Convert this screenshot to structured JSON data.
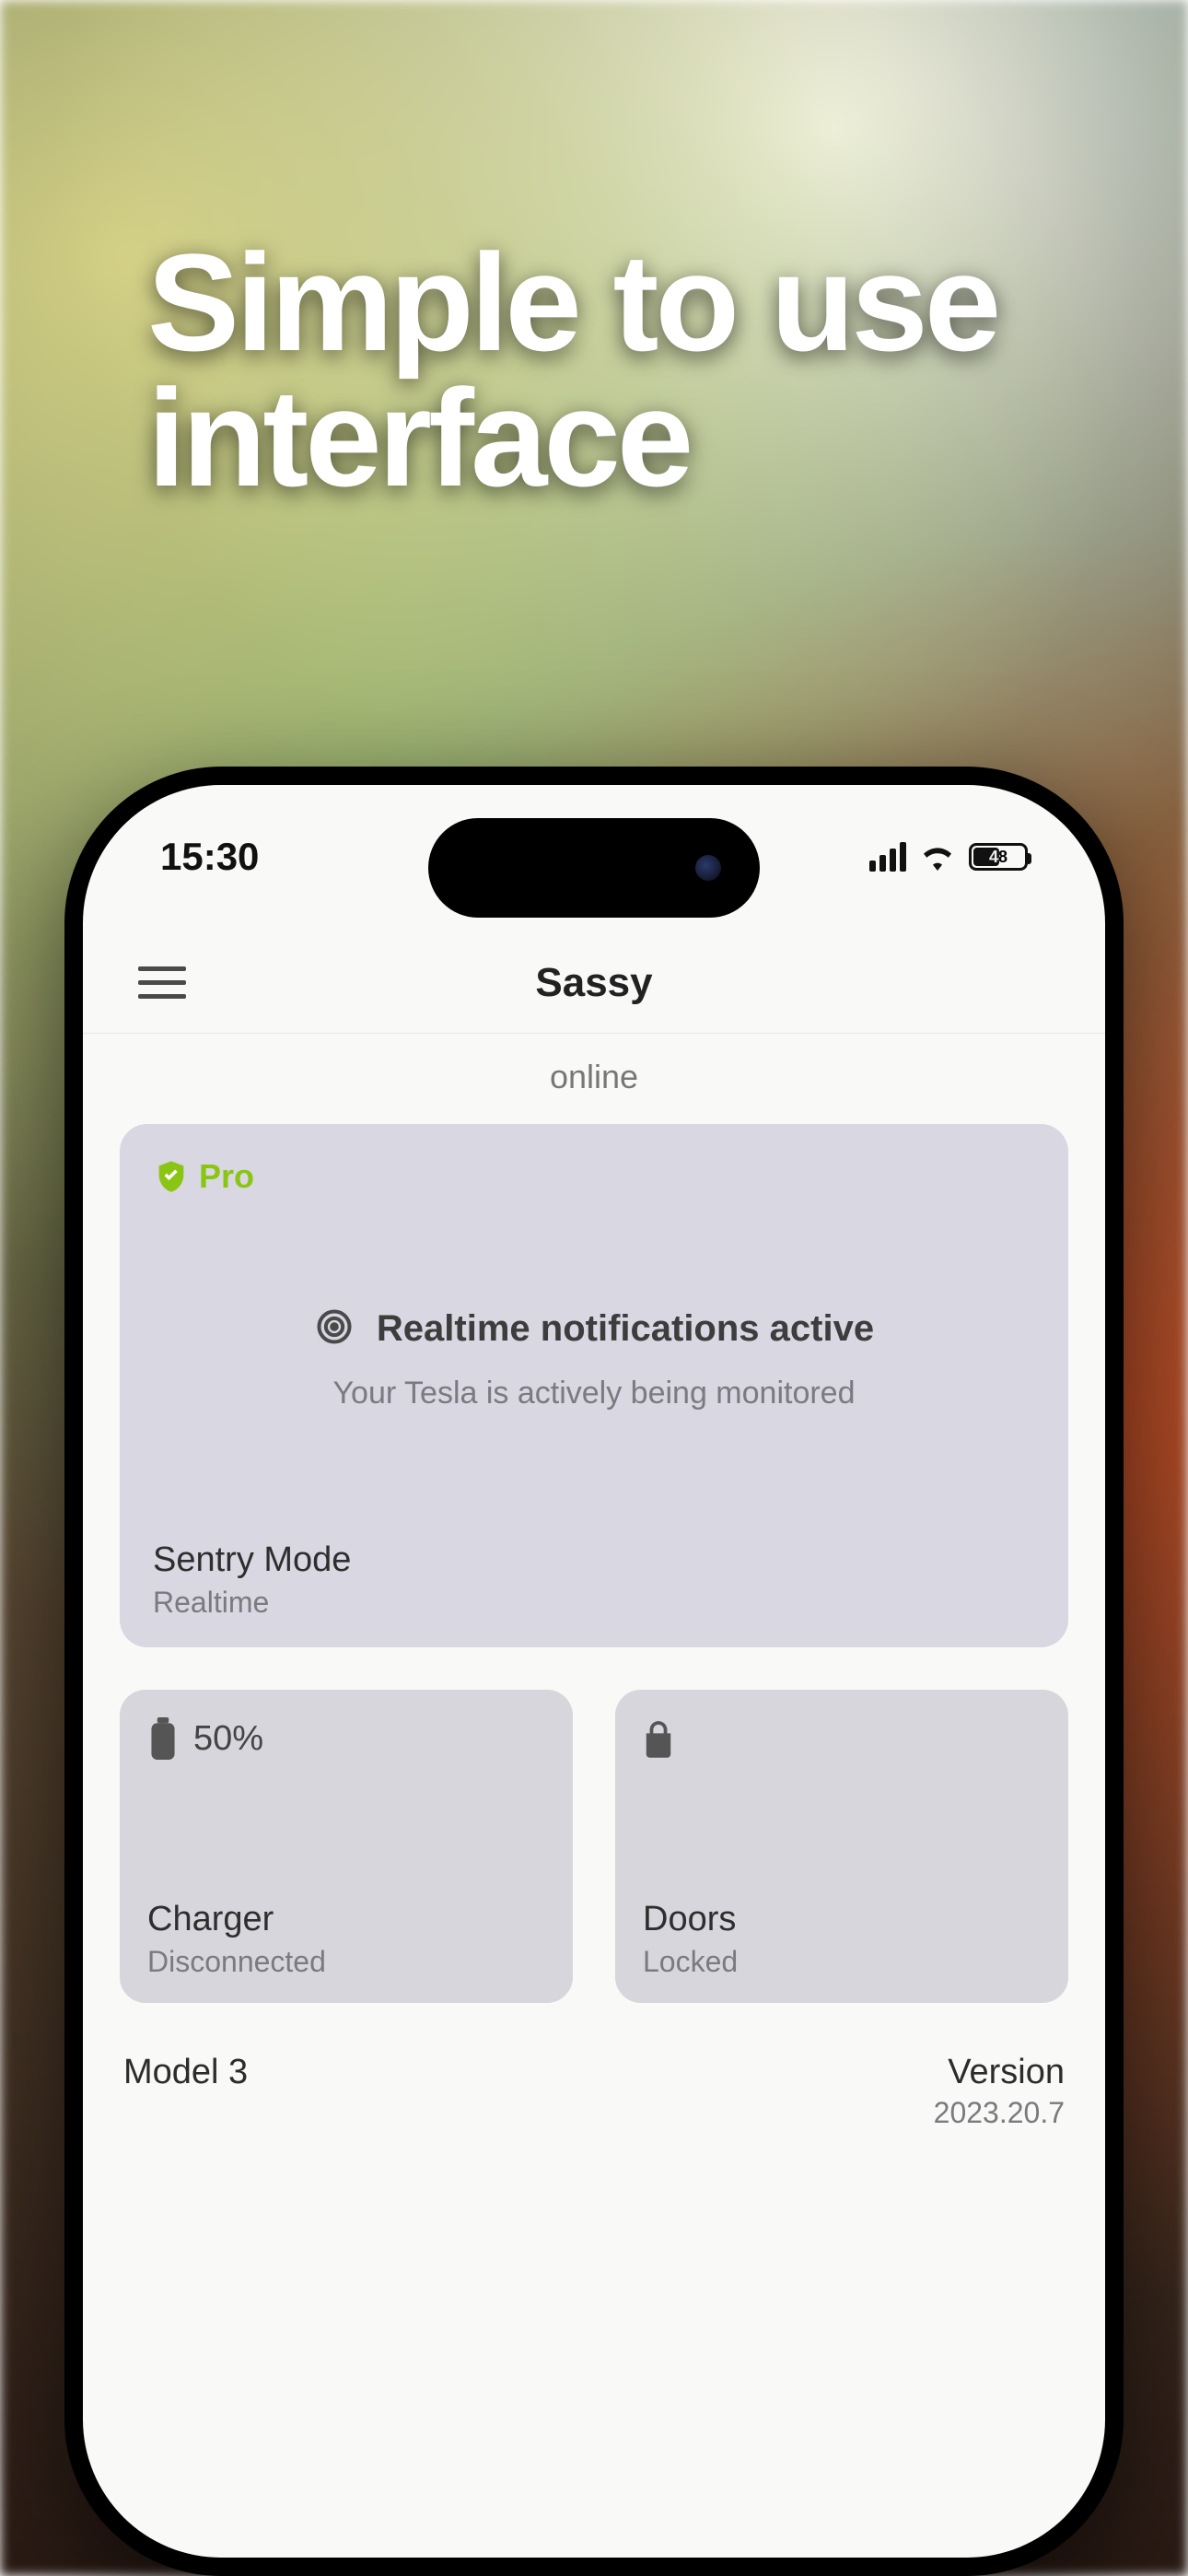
{
  "promo": {
    "headline_line1": "Simple to use",
    "headline_line2": "interface"
  },
  "status_bar": {
    "time": "15:30",
    "battery_pct": "48"
  },
  "header": {
    "title": "Sassy"
  },
  "connection_status": "online",
  "sentry_card": {
    "badge": "Pro",
    "title": "Realtime notifications active",
    "subtitle": "Your Tesla is actively being monitored",
    "footer_title": "Sentry Mode",
    "footer_sub": "Realtime"
  },
  "charger_card": {
    "top_value": "50%",
    "title": "Charger",
    "sub": "Disconnected"
  },
  "doors_card": {
    "title": "Doors",
    "sub": "Locked"
  },
  "footer": {
    "model": "Model 3",
    "version_label": "Version",
    "version_value": "2023.20.7"
  }
}
